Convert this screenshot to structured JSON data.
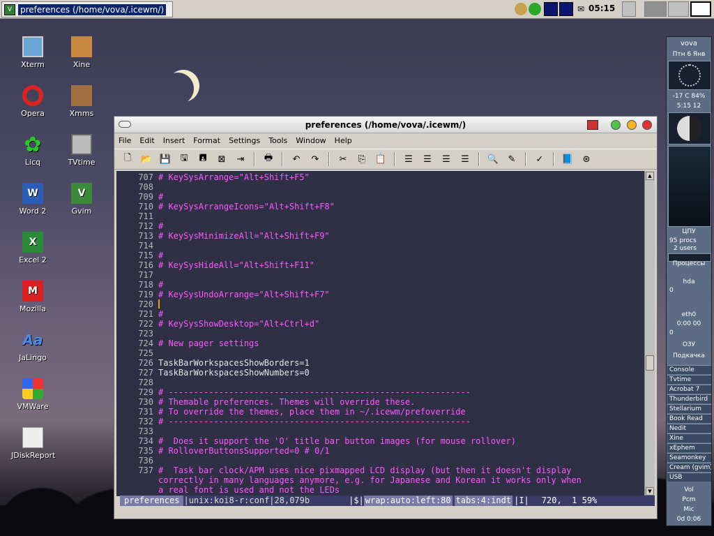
{
  "taskbar": {
    "window_title": "preferences (/home/vova/.icewm/)",
    "clock": "05:15"
  },
  "desktop_icons": [
    {
      "label": "Xterm",
      "icon": "terminal-icon"
    },
    {
      "label": "Xine",
      "icon": "video-player-icon"
    },
    {
      "label": "Opera",
      "icon": "opera-icon"
    },
    {
      "label": "Xmms",
      "icon": "speaker-icon"
    },
    {
      "label": "Licq",
      "icon": "flower-icon"
    },
    {
      "label": "TVtime",
      "icon": "tv-icon"
    },
    {
      "label": "Word 2",
      "icon": "word-icon"
    },
    {
      "label": "Gvim",
      "icon": "vim-icon"
    },
    {
      "label": "Excel 2",
      "icon": "excel-icon"
    },
    {
      "label": "Mozilla",
      "icon": "mozilla-icon"
    },
    {
      "label": "JaLingo",
      "icon": "dictionary-icon"
    },
    {
      "label": "VMWare",
      "icon": "windows-logo-icon"
    },
    {
      "label": "JDiskReport",
      "icon": "chart-icon"
    }
  ],
  "window": {
    "title": "preferences (/home/vova/.icewm/)",
    "menu": [
      "File",
      "Edit",
      "Insert",
      "Format",
      "Settings",
      "Tools",
      "Window",
      "Help"
    ],
    "lines": [
      {
        "n": "707",
        "t": "# KeySysArrange=\"Alt+Shift+F5\""
      },
      {
        "n": "708",
        "t": ""
      },
      {
        "n": "709",
        "t": "#"
      },
      {
        "n": "710",
        "t": "# KeySysArrangeIcons=\"Alt+Shift+F8\""
      },
      {
        "n": "711",
        "t": ""
      },
      {
        "n": "712",
        "t": "#"
      },
      {
        "n": "713",
        "t": "# KeySysMinimizeAll=\"Alt+Shift+F9\""
      },
      {
        "n": "714",
        "t": ""
      },
      {
        "n": "715",
        "t": "#"
      },
      {
        "n": "716",
        "t": "# KeySysHideAll=\"Alt+Shift+F11\""
      },
      {
        "n": "717",
        "t": ""
      },
      {
        "n": "718",
        "t": "#"
      },
      {
        "n": "719",
        "t": "# KeySysUndoArrange=\"Alt+Shift+F7\""
      },
      {
        "n": "720",
        "t": ""
      },
      {
        "n": "721",
        "t": "#"
      },
      {
        "n": "722",
        "t": "# KeySysShowDesktop=\"Alt+Ctrl+d\""
      },
      {
        "n": "723",
        "t": ""
      },
      {
        "n": "724",
        "t": "# New pager settings"
      },
      {
        "n": "725",
        "t": ""
      },
      {
        "n": "726",
        "t": "TaskBarWorkspacesShowBorders=1"
      },
      {
        "n": "727",
        "t": "TaskBarWorkspacesShowNumbers=0"
      },
      {
        "n": "728",
        "t": ""
      },
      {
        "n": "729",
        "t": "# ------------------------------------------------------------"
      },
      {
        "n": "730",
        "t": "# Themable preferences. Themes will override these."
      },
      {
        "n": "731",
        "t": "# To override the themes, place them in ~/.icewm/prefoverride"
      },
      {
        "n": "732",
        "t": "# ------------------------------------------------------------"
      },
      {
        "n": "733",
        "t": ""
      },
      {
        "n": "734",
        "t": "#  Does it support the 'O' title bar button images (for mouse rollover)"
      },
      {
        "n": "735",
        "t": "# RolloverButtonsSupported=0 # 0/1"
      },
      {
        "n": "736",
        "t": ""
      },
      {
        "n": "737",
        "t": "#  Task bar clock/APM uses nice pixmapped LCD display (but then it doesn't display"
      },
      {
        "n": "",
        "t": "correctly in many languages anymore, e.g. for Japanese and Korean it works only when"
      },
      {
        "n": "",
        "t": "a real font is used and not the LEDs"
      }
    ],
    "status": {
      "name": "preferences",
      "format": "|unix:koi8-r:conf|28,079b",
      "mid": "|$|",
      "wrap": "wrap:auto:left:80",
      "tabs": "tabs:4:indt",
      "ins": "|I|",
      "pos": "720,  1 59%"
    }
  },
  "panel": {
    "user": "vova",
    "date": "Птн 6 Янв",
    "temp": "-17 C  84%",
    "time": "5:15  12",
    "cpu_label": "ЦПУ",
    "procs": "95 procs",
    "users": "2 users",
    "processes_label": "Процессы",
    "disk_label": "hda",
    "disk_val": "0",
    "net_label": "eth0",
    "net_time": "0:00 00",
    "net_val": "0",
    "ram_label": "ОЗУ",
    "swap_label": "Подкачка",
    "apps": [
      "Console",
      "Tvtime",
      "Acrobat 7",
      "Thunderbird",
      "Stellarium",
      "Book Read",
      "Nedit",
      "Xine",
      "xEphem",
      "Seamonkey",
      "Cream (gvim)",
      "USB"
    ],
    "vol": "Vol",
    "pcm": "Pcm",
    "mic": "Mic",
    "uptime": "0d 0:06"
  }
}
